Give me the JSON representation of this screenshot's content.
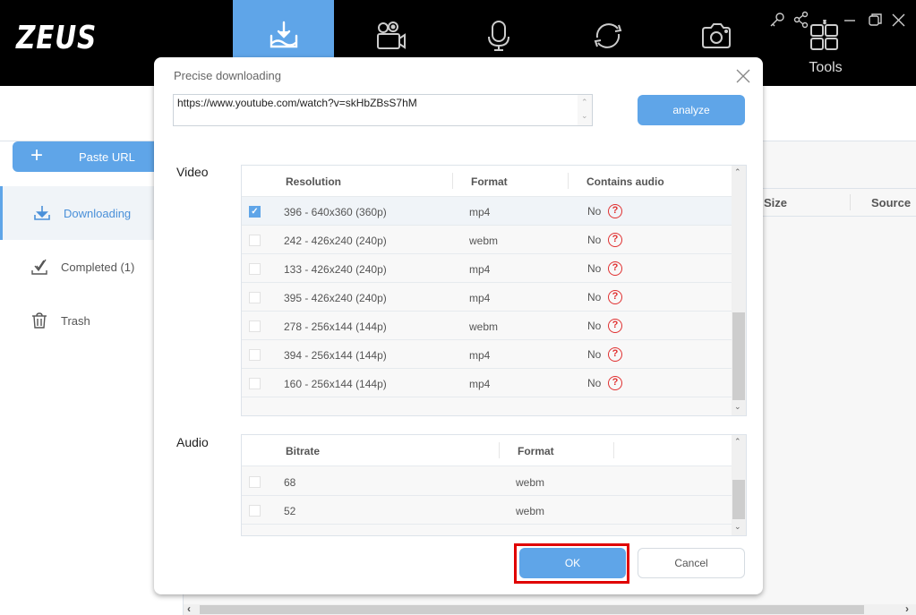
{
  "app": {
    "logo": "ZEUS",
    "nav_tabs": [
      {
        "name": "download",
        "icon": "download-icon",
        "active": true
      },
      {
        "name": "record-video",
        "icon": "video-camera-icon",
        "active": false
      },
      {
        "name": "record-audio",
        "icon": "microphone-icon",
        "active": false
      },
      {
        "name": "convert",
        "icon": "convert-icon",
        "active": false
      },
      {
        "name": "screenshot",
        "icon": "camera-icon",
        "active": false
      }
    ],
    "tools_label": "Tools",
    "window_controls": [
      "key-icon",
      "share-icon",
      "minimize-icon",
      "restore-icon",
      "close-icon"
    ],
    "accent_color": "#5fa5e8"
  },
  "sidebar": {
    "paste_url_label": "Paste URL",
    "items": [
      {
        "label": "Downloading",
        "icon": "download-tray-icon",
        "active": true
      },
      {
        "label": "Completed (1)",
        "icon": "check-icon",
        "active": false
      },
      {
        "label": "Trash",
        "icon": "trash-icon",
        "active": false
      }
    ]
  },
  "main": {
    "columns": [
      "Size",
      "Source"
    ]
  },
  "dialog": {
    "title": "Precise downloading",
    "url_value": "https://www.youtube.com/watch?v=skHbZBsS7hM",
    "analyze_label": "analyze",
    "video": {
      "label": "Video",
      "columns": [
        "Resolution",
        "Format",
        "Contains audio"
      ],
      "rows": [
        {
          "checked": true,
          "resolution": "396 - 640x360 (360p)",
          "format": "mp4",
          "audio": "No"
        },
        {
          "checked": false,
          "resolution": "242 - 426x240 (240p)",
          "format": "webm",
          "audio": "No"
        },
        {
          "checked": false,
          "resolution": "133 - 426x240 (240p)",
          "format": "mp4",
          "audio": "No"
        },
        {
          "checked": false,
          "resolution": "395 - 426x240 (240p)",
          "format": "mp4",
          "audio": "No"
        },
        {
          "checked": false,
          "resolution": "278 - 256x144 (144p)",
          "format": "webm",
          "audio": "No"
        },
        {
          "checked": false,
          "resolution": "394 - 256x144 (144p)",
          "format": "mp4",
          "audio": "No"
        },
        {
          "checked": false,
          "resolution": "160 - 256x144 (144p)",
          "format": "mp4",
          "audio": "No"
        }
      ]
    },
    "audio": {
      "label": "Audio",
      "columns": [
        "Bitrate",
        "Format"
      ],
      "rows": [
        {
          "checked": false,
          "bitrate": "68",
          "format": "webm"
        },
        {
          "checked": false,
          "bitrate": "52",
          "format": "webm"
        }
      ]
    },
    "ok_label": "OK",
    "cancel_label": "Cancel",
    "highlight_color": "#e00000"
  }
}
